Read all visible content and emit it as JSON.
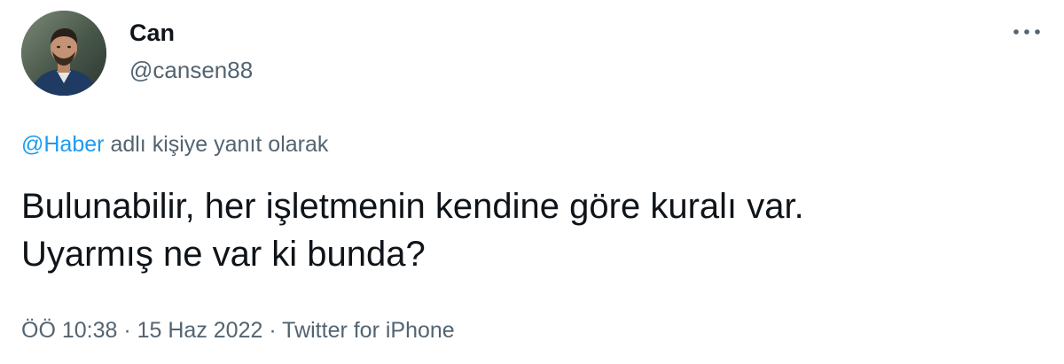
{
  "author": {
    "name": "Can",
    "handle": "@cansen88",
    "avatar_icon": "user-avatar-photo"
  },
  "more_icon": "more-options-icon",
  "reply_context": {
    "mention": "@Haber",
    "suffix": "adlı kişiye yanıt olarak"
  },
  "tweet": {
    "text": "Bulunabilir, her işletmenin kendine göre kuralı var.\nUyarmış ne var ki bunda?"
  },
  "meta": {
    "time": "ÖÖ 10:38",
    "separator_1": " · ",
    "date": "15 Haz 2022",
    "separator_2": " · ",
    "source": "Twitter for iPhone"
  },
  "colors": {
    "text_primary": "#0f1419",
    "text_secondary": "#536471",
    "link": "#1d9bf0"
  }
}
